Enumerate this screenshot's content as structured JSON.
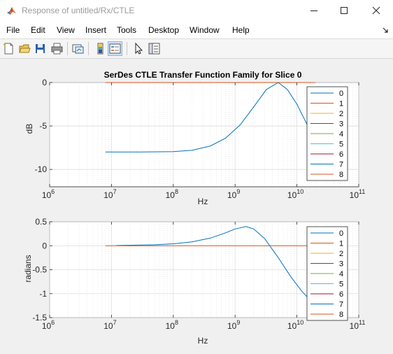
{
  "window": {
    "title": "Response of untitled/Rx/CTLE",
    "controls": {
      "minimize": "minimize",
      "maximize": "maximize",
      "close": "close"
    }
  },
  "menubar": {
    "items": [
      "File",
      "Edit",
      "View",
      "Insert",
      "Tools",
      "Desktop",
      "Window",
      "Help"
    ]
  },
  "toolbar": {
    "icons": [
      "new-figure-icon",
      "open-file-icon",
      "save-icon",
      "print-icon",
      "link-plot-icon",
      "colorbar-icon",
      "legend-icon",
      "pointer-icon",
      "property-inspector-icon"
    ],
    "active": "legend-icon"
  },
  "colors": {
    "line0": "#0072BD",
    "line1": "#D95319",
    "line2": "#EDB120",
    "line3": "#7E2F8E",
    "line4": "#77AC30",
    "line5": "#4DBEEE",
    "line6": "#A2142F"
  },
  "chart_data": [
    {
      "type": "line",
      "title": "SerDes CTLE Transfer Function Family for Slice 0",
      "xlabel": "Hz",
      "ylabel": "dB",
      "xscale": "log",
      "xlim": [
        1000000.0,
        100000000000.0
      ],
      "ylim": [
        -12,
        0
      ],
      "xtick_labels": [
        "10^6",
        "10^7",
        "10^8",
        "10^9",
        "10^10",
        "10^11"
      ],
      "yticks": [
        0,
        -5,
        -10
      ],
      "ytick_labels": [
        "0",
        "-5",
        "-10"
      ],
      "grid": true,
      "legend": [
        "0",
        "1",
        "2",
        "3",
        "4",
        "5",
        "6",
        "7",
        "8"
      ],
      "legend_location": "right",
      "series": [
        {
          "name": "0",
          "color": "#0072BD",
          "x": [
            8000000.0,
            30000000.0,
            100000000.0,
            200000000.0,
            400000000.0,
            700000000.0,
            1200000000.0,
            2000000000.0,
            3200000000.0,
            5000000000.0,
            7000000000.0,
            10000000000.0,
            15000000000.0,
            20000000000.0
          ],
          "y": [
            -8,
            -8,
            -7.95,
            -7.8,
            -7.3,
            -6.4,
            -4.9,
            -2.8,
            -0.8,
            0,
            -0.8,
            -2.5,
            -5,
            -6.5
          ]
        },
        {
          "name": "1",
          "color": "#D95319",
          "x": [
            8000000.0,
            20000000000.0
          ],
          "y": [
            0,
            0
          ]
        }
      ]
    },
    {
      "type": "line",
      "xlabel": "Hz",
      "ylabel": "radians",
      "xscale": "log",
      "xlim": [
        1000000.0,
        100000000000.0
      ],
      "ylim": [
        -1.5,
        0.5
      ],
      "xtick_labels": [
        "10^6",
        "10^7",
        "10^8",
        "10^9",
        "10^10",
        "10^11"
      ],
      "yticks": [
        0.5,
        0,
        -0.5,
        -1,
        -1.5
      ],
      "ytick_labels": [
        "0.5",
        "0",
        "-0.5",
        "-1",
        "-1.5"
      ],
      "grid": true,
      "legend": [
        "0",
        "1",
        "2",
        "3",
        "4",
        "5",
        "6",
        "7",
        "8"
      ],
      "legend_location": "right",
      "series": [
        {
          "name": "0",
          "color": "#0072BD",
          "x": [
            12000000.0,
            50000000.0,
            100000000.0,
            200000000.0,
            400000000.0,
            700000000.0,
            1000000000.0,
            1500000000.0,
            2000000000.0,
            3000000000.0,
            5000000000.0,
            8000000000.0,
            12000000000.0,
            20000000000.0
          ],
          "y": [
            0.005,
            0.02,
            0.04,
            0.08,
            0.16,
            0.27,
            0.35,
            0.4,
            0.35,
            0.15,
            -0.25,
            -0.65,
            -0.95,
            -1.25
          ]
        },
        {
          "name": "1",
          "color": "#D95319",
          "x": [
            8000000.0,
            20000000000.0
          ],
          "y": [
            0,
            0
          ]
        }
      ]
    }
  ]
}
